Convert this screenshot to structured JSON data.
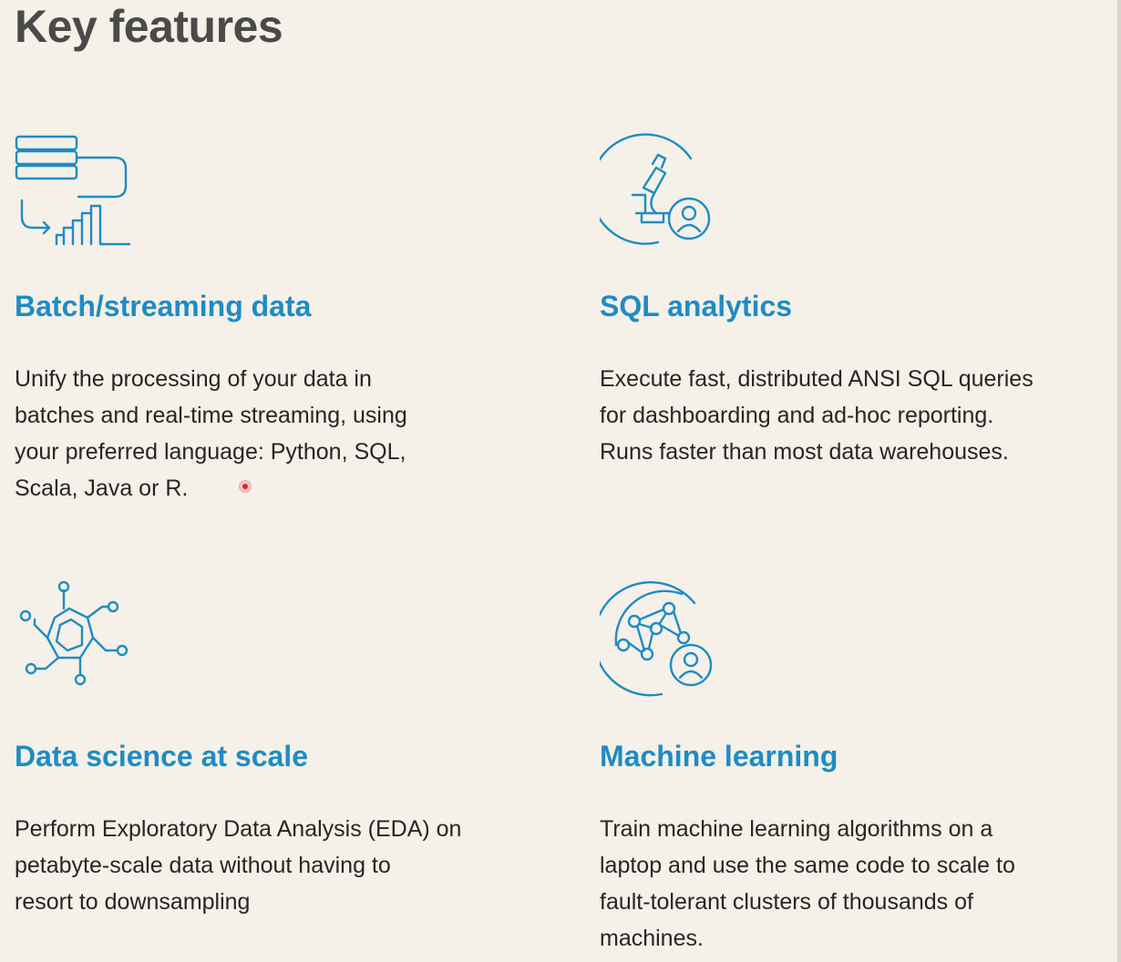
{
  "heading": "Key features",
  "accent_color": "#1e8cc4",
  "features": [
    {
      "icon": "batch-streaming-icon",
      "title": "Batch/streaming data",
      "lines": [
        "Unify the processing of your data in",
        "batches and real-time streaming, using",
        "your preferred language: Python, SQL,",
        "Scala, Java or R."
      ]
    },
    {
      "icon": "sql-analytics-icon",
      "title": "SQL analytics",
      "lines": [
        "Execute fast, distributed ANSI SQL queries",
        "for dashboarding and ad-hoc reporting.",
        "Runs faster than most data warehouses."
      ]
    },
    {
      "icon": "data-science-icon",
      "title": "Data science at scale",
      "lines": [
        "Perform Exploratory Data Analysis (EDA) on",
        "petabyte-scale data without having to",
        "resort to downsampling"
      ]
    },
    {
      "icon": "machine-learning-icon",
      "title": "Machine learning",
      "lines": [
        "Train machine learning algorithms on a",
        "laptop and use the same code to scale to",
        "fault-tolerant clusters of thousands of",
        "machines."
      ]
    }
  ]
}
